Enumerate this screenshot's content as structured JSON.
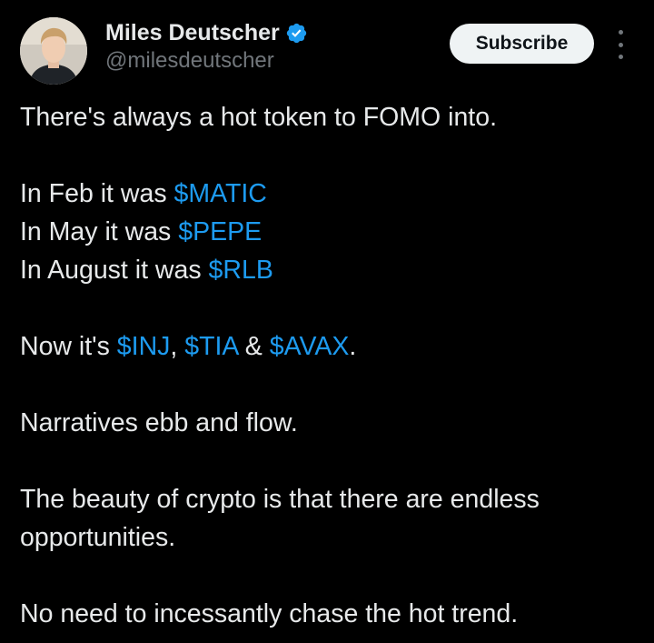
{
  "author": {
    "display_name": "Miles Deutscher",
    "handle": "@milesdeutscher",
    "verified": true,
    "avatar_icon": "profile-photo",
    "badge_icon": "verified-badge-icon"
  },
  "actions": {
    "subscribe_label": "Subscribe",
    "more_icon": "more-options-icon"
  },
  "colors": {
    "background": "#000000",
    "text": "#e7e9ea",
    "secondary": "#71767b",
    "accent": "#1d9bf0"
  },
  "tweet": {
    "line1": "There's always a hot token to FOMO into.",
    "feb_prefix": "In Feb it was ",
    "feb_tag": "$MATIC",
    "may_prefix": "In May it was ",
    "may_tag": "$PEPE",
    "aug_prefix": "In August it was ",
    "aug_tag": "$RLB",
    "now_prefix": "Now it's ",
    "now_tag1": "$INJ",
    "now_sep1": ", ",
    "now_tag2": "$TIA",
    "now_sep2": " & ",
    "now_tag3": "$AVAX",
    "now_suffix": ".",
    "narratives": "Narratives ebb and flow.",
    "beauty": "The beauty of crypto is that there are endless opportunities.",
    "no_need": "No need to incessantly chase the hot trend."
  }
}
